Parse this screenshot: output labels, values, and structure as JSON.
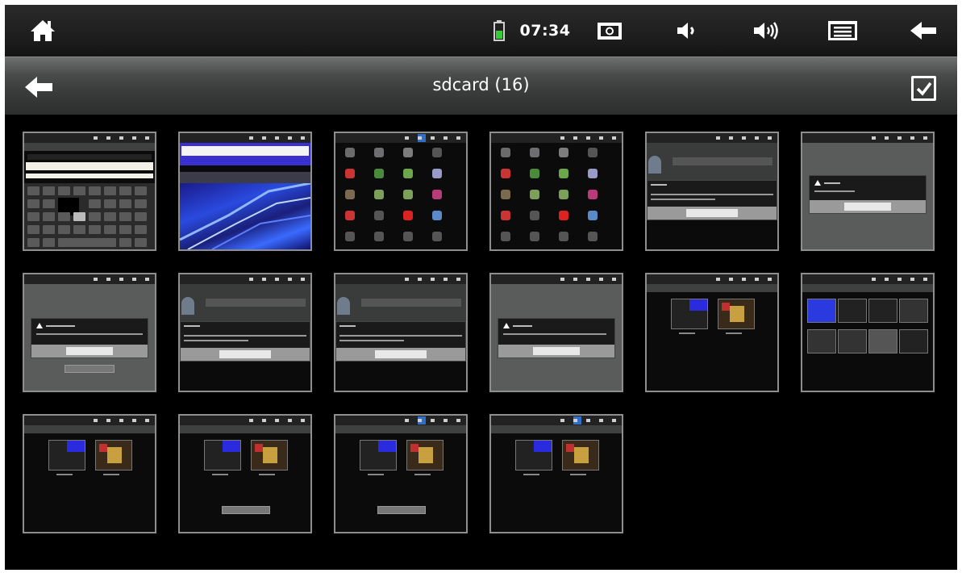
{
  "status_bar": {
    "time": "07:34",
    "icons": [
      "home-icon",
      "battery-icon",
      "screenshot-icon",
      "volume-down-icon",
      "volume-up-icon",
      "menu-icon",
      "back-icon"
    ],
    "battery_color": "#33cc33"
  },
  "title_bar": {
    "title": "sdcard (16)",
    "back_icon": "back-arrow-icon",
    "select_icon": "checkbox-checked-icon"
  },
  "gallery": {
    "item_count": 16,
    "thumbnails": [
      {
        "kind": "keyboard"
      },
      {
        "kind": "wallpaper"
      },
      {
        "kind": "app-drawer"
      },
      {
        "kind": "app-drawer"
      },
      {
        "kind": "account-dialog"
      },
      {
        "kind": "alert-dialog"
      },
      {
        "kind": "alert-dialog-grey"
      },
      {
        "kind": "account-dialog"
      },
      {
        "kind": "account-dialog"
      },
      {
        "kind": "alert-dialog-grey"
      },
      {
        "kind": "gallery-view"
      },
      {
        "kind": "gallery-grid"
      },
      {
        "kind": "gallery-view"
      },
      {
        "kind": "gallery-view-button"
      },
      {
        "kind": "gallery-view-button"
      },
      {
        "kind": "gallery-view"
      }
    ]
  },
  "colors": {
    "background": "#000000",
    "thumbnail_border": "#8e8e8e",
    "title_bar": "#4a4c4c"
  }
}
